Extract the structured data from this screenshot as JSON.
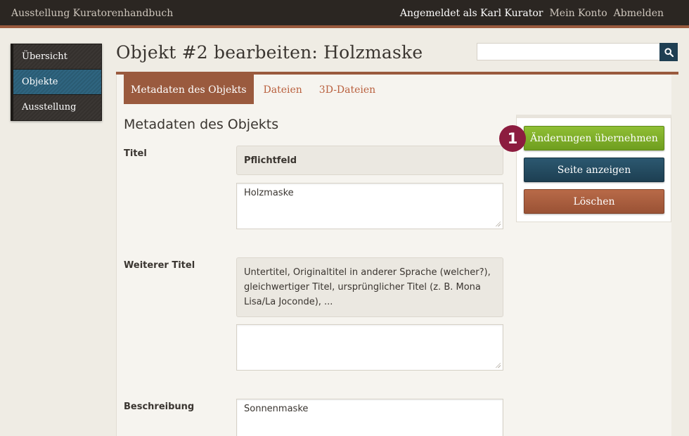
{
  "topbar": {
    "site_title": "Ausstellung Kuratorenhandbuch",
    "logged_in_as": "Angemeldet als Karl Kurator",
    "my_account": "Mein Konto",
    "logout": "Abmelden"
  },
  "sidebar": {
    "items": [
      {
        "label": "Übersicht"
      },
      {
        "label": "Objekte",
        "active": true
      },
      {
        "label": "Ausstellung"
      }
    ]
  },
  "page": {
    "title": "Objekt #2 bearbeiten: Holzmaske"
  },
  "search": {
    "value": "",
    "icon": "search-icon"
  },
  "tabs": [
    {
      "label": "Metadaten des Objekts",
      "active": true
    },
    {
      "label": "Dateien"
    },
    {
      "label": "3D-Dateien"
    }
  ],
  "form": {
    "section_title": "Metadaten des Objekts",
    "fields": [
      {
        "label": "Titel",
        "hint": "Pflichtfeld",
        "value": "Holzmaske"
      },
      {
        "label": "Weiterer Titel",
        "hint": "Untertitel, Originaltitel in anderer Sprache (welcher?), gleichwertiger Titel, ursprünglicher Titel (z. B. Mona Lisa/La Joconde), ...",
        "value": ""
      },
      {
        "label": "Beschreibung",
        "value": "Sonnenmaske"
      }
    ]
  },
  "actions": {
    "save": "Änderungen übernehmen",
    "view": "Seite anzeigen",
    "delete": "Löschen"
  },
  "callout": {
    "number": "1"
  },
  "colors": {
    "topbar": "#2b2622",
    "accent": "#9a5a3e",
    "nav_active": "#2f6580",
    "save": "#7fae2a",
    "view": "#1f3f52",
    "delete": "#9a5235",
    "callout": "#8c1c3f"
  }
}
